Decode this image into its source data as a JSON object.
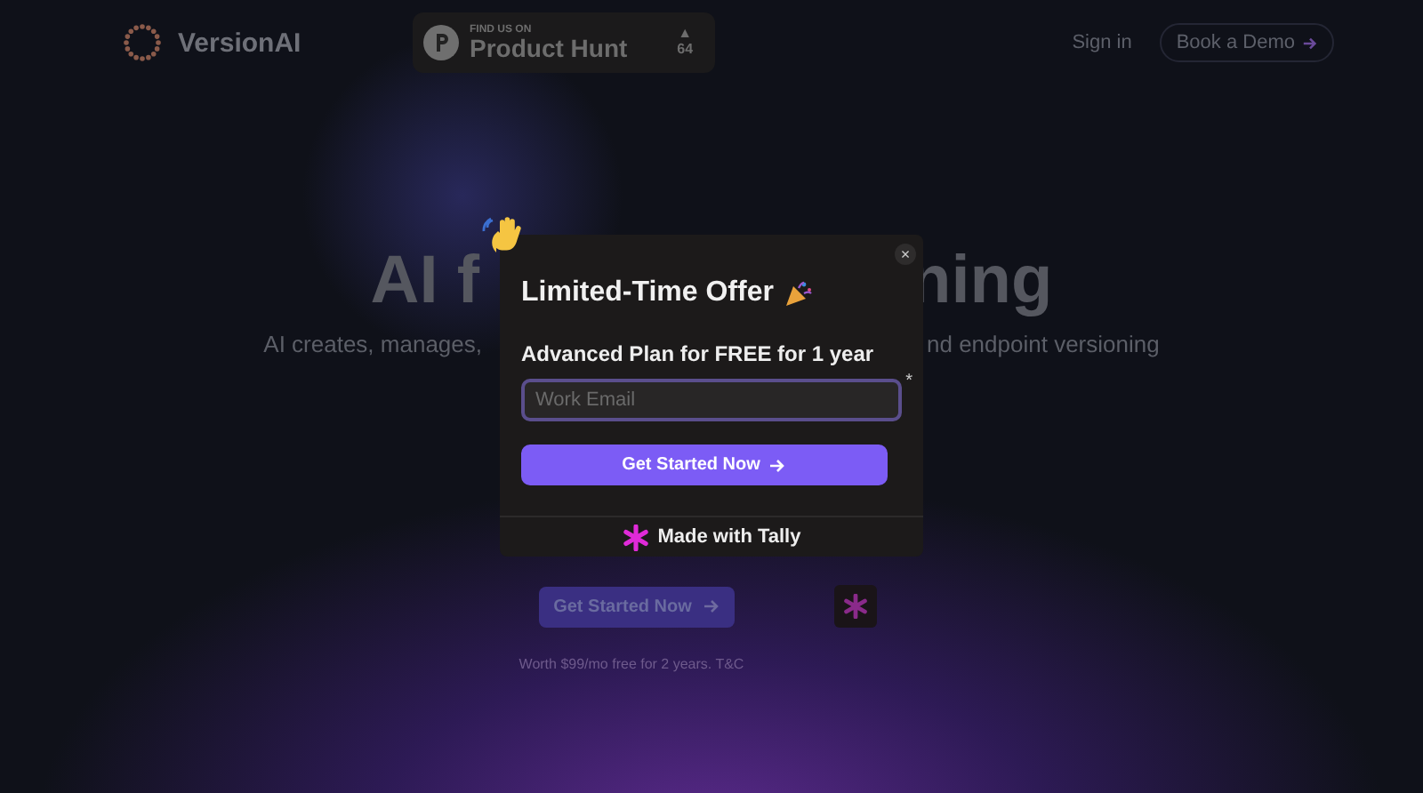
{
  "header": {
    "logo": "VersionAI",
    "badge": {
      "kicker": "FIND US ON",
      "name": "Product Hunt",
      "arrow": "▲",
      "count": "64"
    },
    "nav": [
      {
        "kind": "link",
        "label": "Sign in"
      },
      {
        "kind": "button",
        "label": "Book a Demo"
      }
    ]
  },
  "hero": {
    "title_left": "AI f",
    "title_right": "ning",
    "subtitle_left": "AI creates, manages,",
    "subtitle_right": "nd endpoint versioning",
    "cta": "Get Started Now",
    "note": "Worth $99/mo free for 2 years. T&C"
  },
  "modal": {
    "close": "×",
    "title": "Limited-Time Offer",
    "subtitle": "Advanced Plan for FREE for 1 year",
    "field": {
      "placeholder": "Work Email",
      "required_mark": "*"
    },
    "submit": "Get Started Now",
    "footer": "Made with Tally"
  }
}
